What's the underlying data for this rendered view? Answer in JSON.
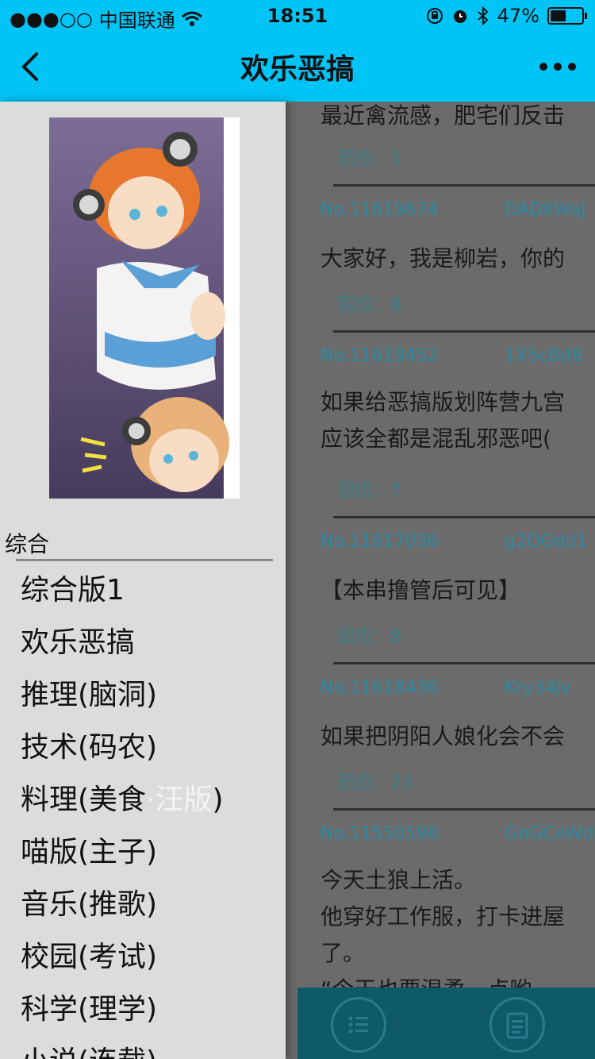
{
  "status_bar": {
    "signal": "●●●○○",
    "carrier": "中国联通",
    "time": "18:51",
    "battery_percent": "47%"
  },
  "nav": {
    "title": "欢乐恶搞"
  },
  "threads": [
    {
      "snippet": "最近禽流感，肥宅们反击",
      "reply_label": "回应：",
      "reply_count": "1"
    },
    {
      "id": "No.11619674",
      "user": "DADKWaJ",
      "snippet": "大家好，我是柳岩，你的",
      "reply_label": "回应：",
      "reply_count": "8"
    },
    {
      "id": "No.11619452",
      "user": "1X5cBd8",
      "snippet": "如果给恶搞版划阵营九宫\n应该全都是混乱邪恶吧( ",
      "reply_label": "回应：",
      "reply_count": "7"
    },
    {
      "id": "No.11617036",
      "user": "g2OGdd1",
      "snippet": "【本串撸管后可见】",
      "reply_label": "回应：",
      "reply_count": "8"
    },
    {
      "id": "No.11618436",
      "user": "Kry34jv",
      "snippet": "如果把阴阳人娘化会不会",
      "reply_label": "回应：",
      "reply_count": "23"
    },
    {
      "id": "No.11550598",
      "user": "GnGCeWd",
      "snippet": "今天土狼上活。\n他穿好工作服，打卡进屋\n了。\n“今天也要温柔一点哟"
    }
  ],
  "drawer": {
    "section_label": "综合",
    "forums": [
      {
        "label": "综合版1"
      },
      {
        "label": "欢乐恶搞"
      },
      {
        "label": "推理(脑洞)"
      },
      {
        "label": "技术(码农)"
      },
      {
        "label_prefix": "料理(美食",
        "label_highlight": "·汪版",
        "label_suffix": ")"
      },
      {
        "label": "喵版(主子)"
      },
      {
        "label": "音乐(推歌)"
      },
      {
        "label": "校园(考试)"
      },
      {
        "label": "科学(理学)"
      },
      {
        "label": "小说(连载)"
      }
    ]
  },
  "colors": {
    "accent": "#00c4f5",
    "drawer_bg": "#dcdcdc",
    "content_dim": "#6b6b6b",
    "toolbar": "#0e5a6a",
    "meta_text": "#2e8aa3"
  },
  "icons": {
    "wifi": "wifi-icon",
    "back": "chevron-left-icon",
    "more": "more-dots-icon",
    "list": "list-icon",
    "document": "document-icon"
  }
}
